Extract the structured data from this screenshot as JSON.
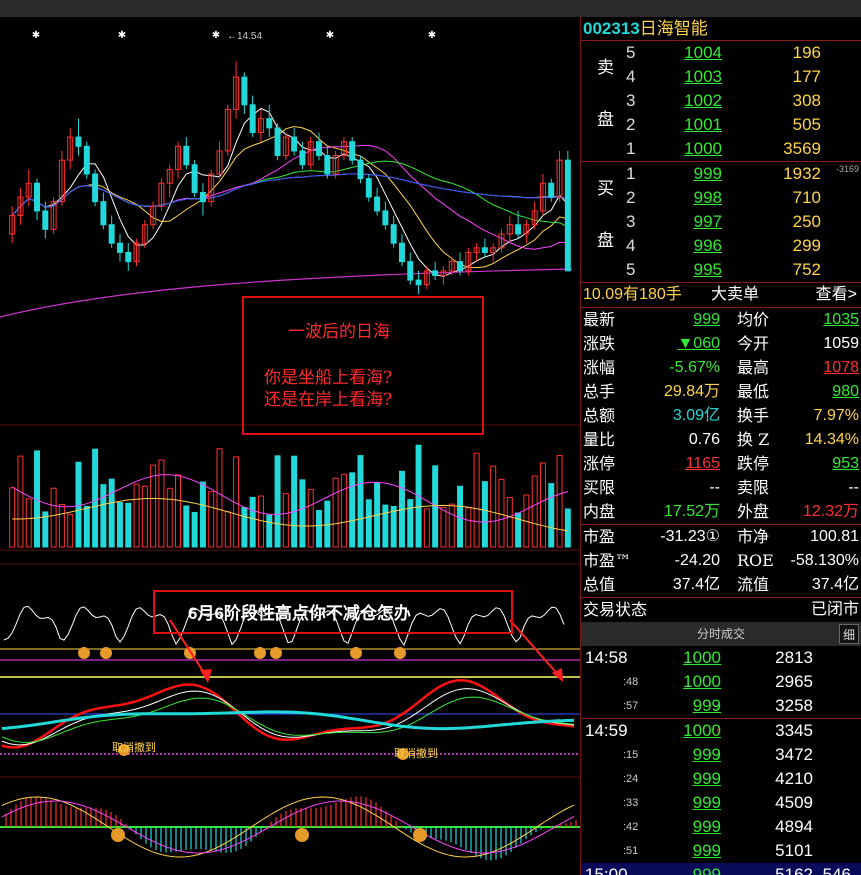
{
  "chart": {
    "high_marker": "14.54",
    "annotation1": {
      "line1": "一波后的日海",
      "line2": "你是坐船上看海?",
      "line3": "还是在岸上看海?"
    },
    "annotation2": "6月6阶段性高点你不减仓怎办",
    "cancel_labels": [
      "取消撤到",
      "取消撤到"
    ]
  },
  "stock": {
    "code": "002313",
    "name": "日海智能"
  },
  "order_book": {
    "sell_label": "卖\n\n盘",
    "buy_label": "买\n\n盘",
    "sell": [
      {
        "level": "5",
        "price": "1004",
        "volume": "196"
      },
      {
        "level": "4",
        "price": "1003",
        "volume": "177"
      },
      {
        "level": "3",
        "price": "1002",
        "volume": "308"
      },
      {
        "level": "2",
        "price": "1001",
        "volume": "505"
      },
      {
        "level": "1",
        "price": "1000",
        "volume": "3569"
      }
    ],
    "buy": [
      {
        "level": "1",
        "price": "999",
        "volume": "1932"
      },
      {
        "level": "2",
        "price": "998",
        "volume": "710"
      },
      {
        "level": "3",
        "price": "997",
        "volume": "250"
      },
      {
        "level": "4",
        "price": "996",
        "volume": "299"
      },
      {
        "level": "5",
        "price": "995",
        "volume": "752"
      }
    ],
    "side_note": "-3169"
  },
  "trade_strip": {
    "left": "10.09有180手",
    "middle": "大卖单",
    "right": "查看>"
  },
  "quotes": [
    {
      "l": "最新",
      "lv": "999",
      "lc": "c-green u",
      "r": "均价",
      "rv": "1035",
      "rc": "c-green u"
    },
    {
      "l": "涨跌",
      "lv": "▼060",
      "lc": "c-green u",
      "r": "今开",
      "rv": "1059",
      "rc": "c-white"
    },
    {
      "l": "涨幅",
      "lv": "-5.67%",
      "lc": "c-green",
      "r": "最高",
      "rv": "1078",
      "rc": "c-red u"
    },
    {
      "l": "总手",
      "lv": "29.84万",
      "lc": "c-yellow",
      "r": "最低",
      "rv": "980",
      "rc": "c-green u"
    },
    {
      "l": "总额",
      "lv": "3.09亿",
      "lc": "c-cyan",
      "r": "换手",
      "rv": "7.97%",
      "rc": "c-yellow"
    },
    {
      "l": "量比",
      "lv": "0.76",
      "lc": "c-white",
      "r": "换 Z",
      "rv": "14.34%",
      "rc": "c-yellow"
    },
    {
      "l": "涨停",
      "lv": "1165",
      "lc": "c-red u",
      "r": "跌停",
      "rv": "953",
      "rc": "c-green u"
    },
    {
      "l": "买限",
      "lv": "--",
      "lc": "c-white",
      "r": "卖限",
      "rv": "--",
      "rc": "c-white"
    },
    {
      "l": "内盘",
      "lv": "17.52万",
      "lc": "c-green",
      "r": "外盘",
      "rv": "12.32万",
      "rc": "c-red"
    },
    {
      "l": "市盈",
      "lv": "-31.23①",
      "lc": "c-white",
      "r": "市净",
      "rv": "100.81",
      "rc": "c-white"
    },
    {
      "l": "市盈™",
      "lv": "-24.20",
      "lc": "c-white",
      "r": "ROE",
      "rv": "-58.130%",
      "rc": "c-white"
    },
    {
      "l": "总值",
      "lv": "37.4亿",
      "lc": "c-white",
      "r": "流值",
      "rv": "37.4亿",
      "rc": "c-white"
    },
    {
      "l": "交易状态",
      "lv": "",
      "lc": "c-white",
      "r": "",
      "rv": "已闭市",
      "rc": "c-white"
    }
  ],
  "time_sales": {
    "header": "分时成交",
    "detail_button": "细",
    "rows": [
      {
        "time": "14:58",
        "small": false,
        "price": "1000",
        "arrow": "",
        "volume": "2813"
      },
      {
        "time": ":48",
        "small": true,
        "price": "1000",
        "arrow": "",
        "volume": "2965"
      },
      {
        "time": ":57",
        "small": true,
        "price": "999",
        "arrow": "↓",
        "volume": "3258"
      },
      {
        "time": "14:59",
        "small": false,
        "price": "1000",
        "arrow": "↑",
        "volume": "3345"
      },
      {
        "time": ":15",
        "small": true,
        "price": "999",
        "arrow": "↓",
        "volume": "3472"
      },
      {
        "time": ":24",
        "small": true,
        "price": "999",
        "arrow": "",
        "volume": "4210"
      },
      {
        "time": ":33",
        "small": true,
        "price": "999",
        "arrow": "",
        "volume": "4509"
      },
      {
        "time": ":42",
        "small": true,
        "price": "999",
        "arrow": "",
        "volume": "4894"
      },
      {
        "time": ":51",
        "small": true,
        "price": "999",
        "arrow": "",
        "volume": "5101"
      },
      {
        "time": "15:00",
        "small": false,
        "price": "999",
        "arrow": "",
        "volume": "5162",
        "extra": "546"
      }
    ]
  },
  "colors": {
    "up": "#ff3030",
    "down": "#22d8d8",
    "accent_green": "#33e833",
    "accent_yellow": "#ffd34a"
  },
  "chart_data": {
    "type": "candlestick",
    "candles": [
      [
        10.8,
        11.4,
        10.6,
        11.2
      ],
      [
        11.2,
        11.8,
        11.0,
        11.6
      ],
      [
        11.6,
        12.2,
        11.4,
        11.9
      ],
      [
        11.9,
        12.0,
        11.1,
        11.3
      ],
      [
        11.3,
        11.5,
        10.7,
        10.9
      ],
      [
        10.9,
        11.6,
        10.8,
        11.5
      ],
      [
        11.5,
        12.6,
        11.4,
        12.4
      ],
      [
        12.4,
        13.1,
        12.2,
        12.9
      ],
      [
        12.9,
        13.3,
        12.5,
        12.7
      ],
      [
        12.7,
        12.8,
        12.0,
        12.1
      ],
      [
        12.1,
        12.2,
        11.4,
        11.5
      ],
      [
        11.5,
        11.7,
        10.9,
        11.0
      ],
      [
        11.0,
        11.2,
        10.5,
        10.6
      ],
      [
        10.6,
        10.8,
        10.2,
        10.4
      ],
      [
        10.4,
        10.6,
        10.0,
        10.2
      ],
      [
        10.2,
        10.7,
        10.1,
        10.6
      ],
      [
        10.6,
        11.1,
        10.5,
        11.0
      ],
      [
        11.0,
        11.5,
        10.9,
        11.4
      ],
      [
        11.4,
        12.0,
        11.3,
        11.9
      ],
      [
        11.9,
        12.3,
        11.6,
        12.2
      ],
      [
        12.2,
        12.8,
        12.0,
        12.7
      ],
      [
        12.7,
        12.9,
        12.2,
        12.3
      ],
      [
        12.3,
        12.4,
        11.6,
        11.7
      ],
      [
        11.7,
        11.9,
        11.2,
        11.5
      ],
      [
        11.5,
        12.2,
        11.4,
        12.1
      ],
      [
        12.1,
        12.8,
        12.0,
        12.6
      ],
      [
        12.6,
        13.6,
        12.5,
        13.5
      ],
      [
        13.5,
        14.54,
        13.3,
        14.2
      ],
      [
        14.2,
        14.3,
        13.4,
        13.6
      ],
      [
        13.6,
        13.8,
        12.9,
        13.0
      ],
      [
        13.0,
        13.5,
        12.8,
        13.3
      ],
      [
        13.3,
        13.6,
        12.9,
        13.1
      ],
      [
        13.1,
        13.2,
        12.4,
        12.5
      ],
      [
        12.5,
        13.0,
        12.4,
        12.9
      ],
      [
        12.9,
        13.1,
        12.5,
        12.6
      ],
      [
        12.6,
        12.8,
        12.2,
        12.3
      ],
      [
        12.3,
        12.9,
        12.2,
        12.8
      ],
      [
        12.8,
        13.0,
        12.4,
        12.5
      ],
      [
        12.5,
        12.7,
        12.0,
        12.1
      ],
      [
        12.1,
        12.6,
        12.0,
        12.5
      ],
      [
        12.5,
        12.9,
        12.4,
        12.8
      ],
      [
        12.8,
        12.9,
        12.3,
        12.4
      ],
      [
        12.4,
        12.5,
        11.9,
        12.0
      ],
      [
        12.0,
        12.1,
        11.5,
        11.6
      ],
      [
        11.6,
        11.8,
        11.2,
        11.3
      ],
      [
        11.3,
        11.5,
        10.9,
        11.0
      ],
      [
        11.0,
        11.2,
        10.5,
        10.6
      ],
      [
        10.6,
        10.8,
        10.1,
        10.2
      ],
      [
        10.2,
        10.4,
        9.7,
        9.8
      ],
      [
        9.8,
        10.0,
        9.5,
        9.7
      ],
      [
        9.7,
        10.1,
        9.6,
        10.0
      ],
      [
        10.0,
        10.2,
        9.8,
        9.9
      ],
      [
        9.9,
        10.1,
        9.7,
        10.0
      ],
      [
        10.0,
        10.3,
        9.9,
        10.2
      ],
      [
        10.2,
        10.4,
        9.9,
        10.0
      ],
      [
        10.0,
        10.5,
        9.9,
        10.4
      ],
      [
        10.4,
        10.6,
        10.2,
        10.5
      ],
      [
        10.5,
        10.7,
        10.3,
        10.4
      ],
      [
        10.4,
        10.6,
        10.2,
        10.5
      ],
      [
        10.5,
        10.9,
        10.4,
        10.8
      ],
      [
        10.8,
        11.2,
        10.6,
        11.0
      ],
      [
        11.0,
        11.3,
        10.7,
        10.8
      ],
      [
        10.8,
        11.1,
        10.6,
        11.0
      ],
      [
        11.0,
        11.5,
        10.9,
        11.3
      ],
      [
        11.3,
        12.1,
        11.2,
        11.9
      ],
      [
        11.9,
        12.0,
        11.5,
        11.6
      ],
      [
        11.6,
        12.6,
        11.5,
        12.4
      ],
      [
        12.4,
        12.6,
        10.6,
        10.0
      ]
    ],
    "ylim": [
      9.0,
      15.2
    ]
  }
}
